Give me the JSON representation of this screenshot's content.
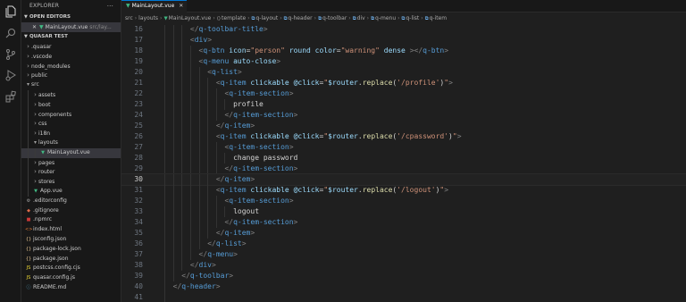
{
  "explorer": {
    "title": "EXPLORER",
    "more_label": "···",
    "open_editors_label": "OPEN EDITORS",
    "open_editor": {
      "close_glyph": "✕",
      "name": "MainLayout.vue",
      "path": "src/lay..."
    },
    "project_label": "QUASAR TEST",
    "tree": [
      {
        "label": ".quasar",
        "kind": "folder",
        "depth": 1,
        "expanded": false
      },
      {
        "label": ".vscode",
        "kind": "folder",
        "depth": 1,
        "expanded": false
      },
      {
        "label": "node_modules",
        "kind": "folder",
        "depth": 1,
        "expanded": false
      },
      {
        "label": "public",
        "kind": "folder",
        "depth": 1,
        "expanded": false
      },
      {
        "label": "src",
        "kind": "folder",
        "depth": 1,
        "expanded": true
      },
      {
        "label": "assets",
        "kind": "folder",
        "depth": 2,
        "expanded": false
      },
      {
        "label": "boot",
        "kind": "folder",
        "depth": 2,
        "expanded": false
      },
      {
        "label": "components",
        "kind": "folder",
        "depth": 2,
        "expanded": false
      },
      {
        "label": "css",
        "kind": "folder",
        "depth": 2,
        "expanded": false
      },
      {
        "label": "i18n",
        "kind": "folder",
        "depth": 2,
        "expanded": false
      },
      {
        "label": "layouts",
        "kind": "folder",
        "depth": 2,
        "expanded": true
      },
      {
        "label": "MainLayout.vue",
        "kind": "vue",
        "depth": 3,
        "selected": true
      },
      {
        "label": "pages",
        "kind": "folder",
        "depth": 2,
        "expanded": false
      },
      {
        "label": "router",
        "kind": "folder",
        "depth": 2,
        "expanded": false
      },
      {
        "label": "stores",
        "kind": "folder",
        "depth": 2,
        "expanded": false
      },
      {
        "label": "App.vue",
        "kind": "vue",
        "depth": 2
      },
      {
        "label": ".editorconfig",
        "kind": "config",
        "depth": 1
      },
      {
        "label": ".gitignore",
        "kind": "git",
        "depth": 1
      },
      {
        "label": ".npmrc",
        "kind": "npm",
        "depth": 1
      },
      {
        "label": "index.html",
        "kind": "html",
        "depth": 1
      },
      {
        "label": "jsconfig.json",
        "kind": "json",
        "depth": 1
      },
      {
        "label": "package-lock.json",
        "kind": "json",
        "depth": 1
      },
      {
        "label": "package.json",
        "kind": "json",
        "depth": 1
      },
      {
        "label": "postcss.config.cjs",
        "kind": "js",
        "depth": 1
      },
      {
        "label": "quasar.config.js",
        "kind": "js",
        "depth": 1
      },
      {
        "label": "README.md",
        "kind": "md",
        "depth": 1
      }
    ]
  },
  "tab": {
    "label": "MainLayout.vue",
    "close_glyph": "✕"
  },
  "breadcrumb": [
    "src",
    "layouts",
    "MainLayout.vue",
    "template",
    "q-layout",
    "q-header",
    "q-toolbar",
    "div",
    "q-menu",
    "q-list",
    "q-item"
  ],
  "editor": {
    "current_line": 30,
    "lines": [
      {
        "n": 16,
        "indent": 4,
        "tokens": [
          [
            "</",
            "br"
          ],
          [
            "q-toolbar-title",
            "tag"
          ],
          [
            ">",
            "br"
          ]
        ]
      },
      {
        "n": 17,
        "indent": 4,
        "tokens": [
          [
            "<",
            "br"
          ],
          [
            "div",
            "tag"
          ],
          [
            ">",
            "br"
          ]
        ]
      },
      {
        "n": 18,
        "indent": 5,
        "tokens": [
          [
            "<",
            "br"
          ],
          [
            "q-btn",
            "tag"
          ],
          [
            " ",
            "txt"
          ],
          [
            "icon",
            "attr"
          ],
          [
            "=",
            "op"
          ],
          [
            "\"person\"",
            "str"
          ],
          [
            " ",
            "txt"
          ],
          [
            "round",
            "attr"
          ],
          [
            " ",
            "txt"
          ],
          [
            "color",
            "attr"
          ],
          [
            "=",
            "op"
          ],
          [
            "\"warning\"",
            "str"
          ],
          [
            " ",
            "txt"
          ],
          [
            "dense",
            "attr"
          ],
          [
            " ></",
            "br"
          ],
          [
            "q-btn",
            "tag"
          ],
          [
            ">",
            "br"
          ]
        ]
      },
      {
        "n": 19,
        "indent": 5,
        "tokens": [
          [
            "<",
            "br"
          ],
          [
            "q-menu",
            "tag"
          ],
          [
            " ",
            "txt"
          ],
          [
            "auto-close",
            "attr"
          ],
          [
            ">",
            "br"
          ]
        ]
      },
      {
        "n": 20,
        "indent": 6,
        "tokens": [
          [
            "<",
            "br"
          ],
          [
            "q-list",
            "tag"
          ],
          [
            ">",
            "br"
          ]
        ]
      },
      {
        "n": 21,
        "indent": 7,
        "tokens": [
          [
            "<",
            "br"
          ],
          [
            "q-item",
            "tag"
          ],
          [
            " ",
            "txt"
          ],
          [
            "clickable",
            "attr"
          ],
          [
            " ",
            "txt"
          ],
          [
            "@click",
            "attr"
          ],
          [
            "=",
            "op"
          ],
          [
            "\"",
            "str"
          ],
          [
            "$router",
            "var"
          ],
          [
            ".",
            "op"
          ],
          [
            "replace",
            "fn"
          ],
          [
            "(",
            "op"
          ],
          [
            "'/profile'",
            "str"
          ],
          [
            ")",
            "op"
          ],
          [
            "\"",
            "str"
          ],
          [
            ">",
            "br"
          ]
        ]
      },
      {
        "n": 22,
        "indent": 8,
        "tokens": [
          [
            "<",
            "br"
          ],
          [
            "q-item-section",
            "tag"
          ],
          [
            ">",
            "br"
          ]
        ]
      },
      {
        "n": 23,
        "indent": 9,
        "tokens": [
          [
            "profile",
            "txt"
          ]
        ]
      },
      {
        "n": 24,
        "indent": 8,
        "tokens": [
          [
            "</",
            "br"
          ],
          [
            "q-item-section",
            "tag"
          ],
          [
            ">",
            "br"
          ]
        ]
      },
      {
        "n": 25,
        "indent": 7,
        "tokens": [
          [
            "</",
            "br"
          ],
          [
            "q-item",
            "tag"
          ],
          [
            ">",
            "br"
          ]
        ]
      },
      {
        "n": 26,
        "indent": 7,
        "tokens": [
          [
            "<",
            "br"
          ],
          [
            "q-item",
            "tag"
          ],
          [
            " ",
            "txt"
          ],
          [
            "clickable",
            "attr"
          ],
          [
            " ",
            "txt"
          ],
          [
            "@click",
            "attr"
          ],
          [
            "=",
            "op"
          ],
          [
            "\"",
            "str"
          ],
          [
            "$router",
            "var"
          ],
          [
            ".",
            "op"
          ],
          [
            "replace",
            "fn"
          ],
          [
            "(",
            "op"
          ],
          [
            "'/cpassword'",
            "str"
          ],
          [
            ")",
            "op"
          ],
          [
            "\"",
            "str"
          ],
          [
            ">",
            "br"
          ]
        ]
      },
      {
        "n": 27,
        "indent": 8,
        "tokens": [
          [
            "<",
            "br"
          ],
          [
            "q-item-section",
            "tag"
          ],
          [
            ">",
            "br"
          ]
        ]
      },
      {
        "n": 28,
        "indent": 9,
        "tokens": [
          [
            "change password",
            "txt"
          ]
        ]
      },
      {
        "n": 29,
        "indent": 8,
        "tokens": [
          [
            "</",
            "br"
          ],
          [
            "q-item-section",
            "tag"
          ],
          [
            ">",
            "br"
          ]
        ]
      },
      {
        "n": 30,
        "indent": 7,
        "tokens": [
          [
            "</",
            "br"
          ],
          [
            "q-item",
            "tag"
          ],
          [
            ">",
            "br"
          ]
        ]
      },
      {
        "n": 31,
        "indent": 7,
        "tokens": [
          [
            "<",
            "br"
          ],
          [
            "q-item",
            "tag"
          ],
          [
            " ",
            "txt"
          ],
          [
            "clickable",
            "attr"
          ],
          [
            " ",
            "txt"
          ],
          [
            "@click",
            "attr"
          ],
          [
            "=",
            "op"
          ],
          [
            "\"",
            "str"
          ],
          [
            "$router",
            "var"
          ],
          [
            ".",
            "op"
          ],
          [
            "replace",
            "fn"
          ],
          [
            "(",
            "op"
          ],
          [
            "'/logout'",
            "str"
          ],
          [
            ")",
            "op"
          ],
          [
            "\"",
            "str"
          ],
          [
            ">",
            "br"
          ]
        ]
      },
      {
        "n": 32,
        "indent": 8,
        "tokens": [
          [
            "<",
            "br"
          ],
          [
            "q-item-section",
            "tag"
          ],
          [
            ">",
            "br"
          ]
        ]
      },
      {
        "n": 33,
        "indent": 9,
        "tokens": [
          [
            "logout",
            "txt"
          ]
        ]
      },
      {
        "n": 34,
        "indent": 8,
        "tokens": [
          [
            "</",
            "br"
          ],
          [
            "q-item-section",
            "tag"
          ],
          [
            ">",
            "br"
          ]
        ]
      },
      {
        "n": 35,
        "indent": 7,
        "tokens": [
          [
            "</",
            "br"
          ],
          [
            "q-item",
            "tag"
          ],
          [
            ">",
            "br"
          ]
        ]
      },
      {
        "n": 36,
        "indent": 6,
        "tokens": [
          [
            "</",
            "br"
          ],
          [
            "q-list",
            "tag"
          ],
          [
            ">",
            "br"
          ]
        ]
      },
      {
        "n": 37,
        "indent": 5,
        "tokens": [
          [
            "</",
            "br"
          ],
          [
            "q-menu",
            "tag"
          ],
          [
            ">",
            "br"
          ]
        ]
      },
      {
        "n": 38,
        "indent": 4,
        "tokens": [
          [
            "</",
            "br"
          ],
          [
            "div",
            "tag"
          ],
          [
            ">",
            "br"
          ]
        ]
      },
      {
        "n": 39,
        "indent": 3,
        "tokens": [
          [
            "</",
            "br"
          ],
          [
            "q-toolbar",
            "tag"
          ],
          [
            ">",
            "br"
          ]
        ]
      },
      {
        "n": 40,
        "indent": 2,
        "tokens": [
          [
            "</",
            "br"
          ],
          [
            "q-header",
            "tag"
          ],
          [
            ">",
            "br"
          ]
        ]
      },
      {
        "n": 41,
        "indent": 2,
        "tokens": []
      }
    ]
  },
  "colors": {
    "accent": "#0078d4",
    "vue": "#41b883",
    "tag": "#569cd6",
    "attr": "#9cdcfe",
    "string": "#ce9178",
    "function": "#dcdcaa",
    "json": "#e2c08d",
    "js": "#f1dd35"
  }
}
